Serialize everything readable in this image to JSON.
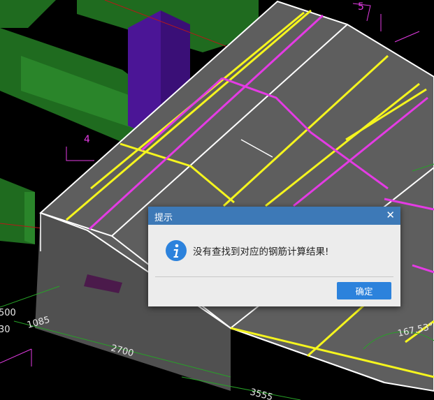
{
  "canvas": {
    "dimension_labels": [
      "4",
      "5",
      "1085",
      "2700",
      "3555",
      "167.53°",
      "500",
      "30"
    ],
    "colors": {
      "background": "#000000",
      "slab": "#5e5e5e",
      "slab_edge": "#ffffff",
      "rebar_yellow": "#f5f51e",
      "rebar_magenta": "#e43be4",
      "beam_green": "#1f6b1f",
      "column_purple": "#4b1596",
      "dimension_green": "#27a127"
    }
  },
  "dialog": {
    "title": "提示",
    "close_symbol": "✕",
    "icon": "info-icon",
    "message": "没有查找到对应的钢筋计算结果!",
    "ok_label": "确定",
    "colors": {
      "titlebar": "#3d79b7",
      "button": "#2c82dc",
      "body": "#ececec"
    }
  }
}
